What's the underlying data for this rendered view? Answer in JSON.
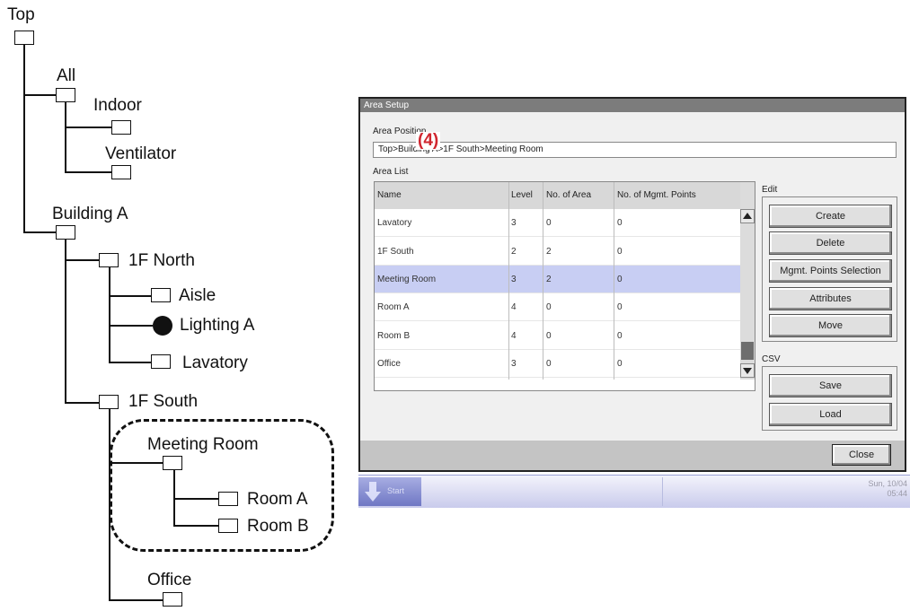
{
  "tree": {
    "top": "Top",
    "all": "All",
    "indoor": "Indoor",
    "ventilator": "Ventilator",
    "building_a": "Building A",
    "north_1f": "1F North",
    "aisle": "Aisle",
    "lighting_a": "Lighting A",
    "lavatory": "Lavatory",
    "south_1f": "1F South",
    "meeting_room": "Meeting Room",
    "room_a": "Room A",
    "room_b": "Room B",
    "office": "Office"
  },
  "dialog": {
    "title": "Area Setup",
    "area_position_label": "Area Position",
    "area_position_value": "Top>Building A>1F South>Meeting Room",
    "area_list_label": "Area List",
    "columns": [
      "Name",
      "Level",
      "No. of Area",
      "No. of Mgmt. Points"
    ],
    "rows": [
      {
        "name": "Lavatory",
        "level": "3",
        "areas": "0",
        "points": "0"
      },
      {
        "name": "1F South",
        "level": "2",
        "areas": "2",
        "points": "0"
      },
      {
        "name": "Meeting Room",
        "level": "3",
        "areas": "2",
        "points": "0"
      },
      {
        "name": "Room A",
        "level": "4",
        "areas": "0",
        "points": "0"
      },
      {
        "name": "Room B",
        "level": "4",
        "areas": "0",
        "points": "0"
      },
      {
        "name": "Office",
        "level": "3",
        "areas": "0",
        "points": "0"
      }
    ],
    "selected_row": "Meeting Room",
    "edit_label": "Edit",
    "edit_buttons": {
      "create": "Create",
      "delete": "Delete",
      "mgmt_points": "Mgmt. Points Selection",
      "attributes": "Attributes",
      "move": "Move"
    },
    "csv_label": "CSV",
    "csv_buttons": {
      "save": "Save",
      "load": "Load"
    },
    "close": "Close",
    "callout": "(4)"
  },
  "taskbar": {
    "start": "Start",
    "date": "Sun, 10/04",
    "time": "05:44"
  },
  "colors": {
    "selected_row": "#c8cef3",
    "callout": "#d0262f",
    "titlebar": "#7c7c7c"
  }
}
